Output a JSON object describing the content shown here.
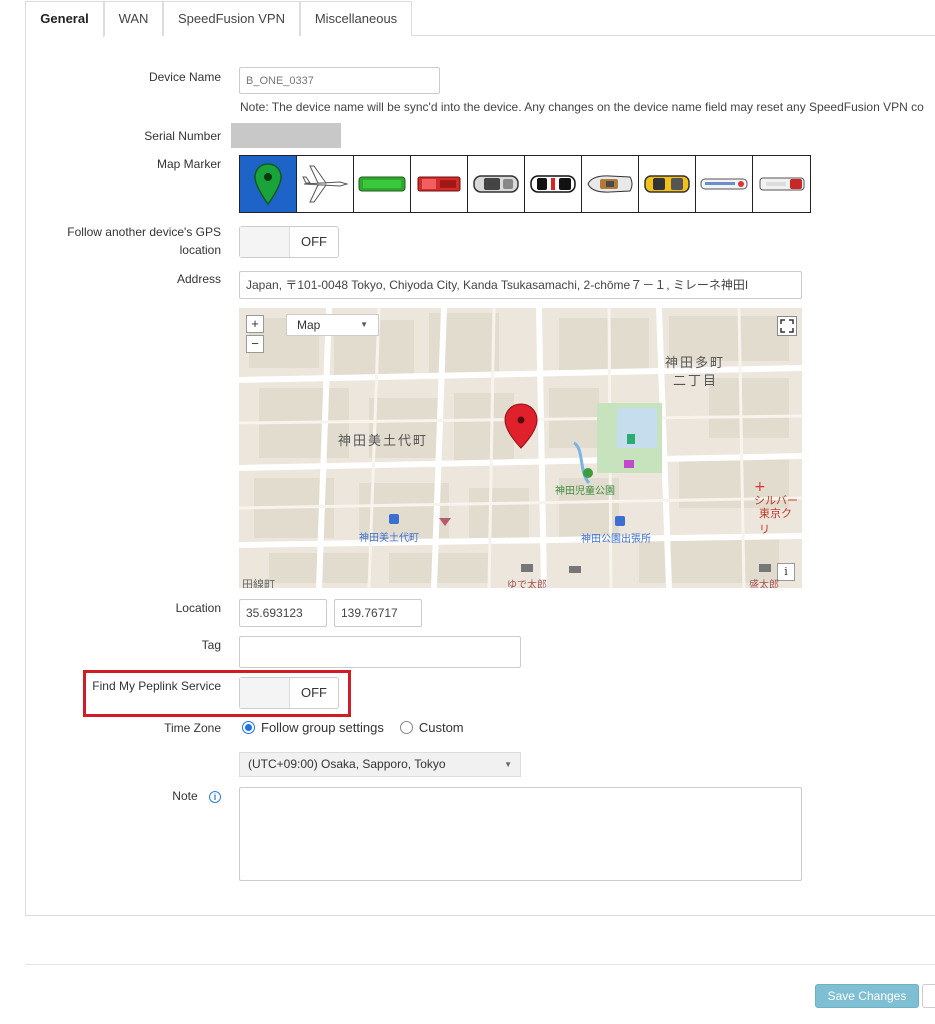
{
  "tabs": [
    {
      "label": "General",
      "active": true
    },
    {
      "label": "WAN",
      "active": false
    },
    {
      "label": "SpeedFusion VPN",
      "active": false
    },
    {
      "label": "Miscellaneous",
      "active": false
    }
  ],
  "form": {
    "device_name_label": "Device Name",
    "device_name_value": "B_ONE_0337",
    "device_name_note": "Note: The device name will be sync'd into the device. Any changes on the device name field may reset any SpeedFusion VPN co",
    "serial_label": "Serial Number",
    "map_marker_label": "Map Marker",
    "map_marker_icons": [
      "pin-marker",
      "airplane",
      "green-bus",
      "red-truck",
      "grey-car",
      "police-car",
      "boat",
      "taxi",
      "train",
      "ambulance"
    ],
    "map_marker_selected": "pin-marker",
    "follow_gps_label_line1": "Follow another device's GPS",
    "follow_gps_label_line2": "location",
    "follow_gps_state": "OFF",
    "address_label": "Address",
    "address_value": "Japan, 〒101-0048 Tokyo, Chiyoda City, Kanda Tsukasamachi, 2-chōme７－１, ミレーネ神田I",
    "map": {
      "zoom_in": "+",
      "zoom_out": "−",
      "map_type": "Map",
      "labels": {
        "district1": "神田多町",
        "district1b": "二丁目",
        "district2": "神田美土代町",
        "park": "神田児童公園",
        "station1": "神田美土代町",
        "station2": "神田公園出張所",
        "silver": "シルバー",
        "tokyo_clinic": "東京クリ",
        "food": "ゆで太郎",
        "edge1": "田線町",
        "edge2": "盛太郎"
      },
      "info": "i"
    },
    "location_label": "Location",
    "latitude": "35.693123",
    "longitude": "139.76717",
    "tag_label": "Tag",
    "tag_value": "",
    "find_my_label": "Find My Peplink Service",
    "find_my_state": "OFF",
    "timezone_label": "Time Zone",
    "tz_option_group": "Follow group settings",
    "tz_option_custom": "Custom",
    "tz_selected": "group",
    "tz_value": "(UTC+09:00) Osaka, Sapporo, Tokyo",
    "note_label": "Note",
    "note_value": ""
  },
  "footer": {
    "save_label": "Save Changes"
  },
  "colors": {
    "selected_marker_bg": "#1e63c7",
    "highlight_border": "#d01c24",
    "save_button": "#7fbfd4",
    "map_pin": "#e0202a"
  }
}
